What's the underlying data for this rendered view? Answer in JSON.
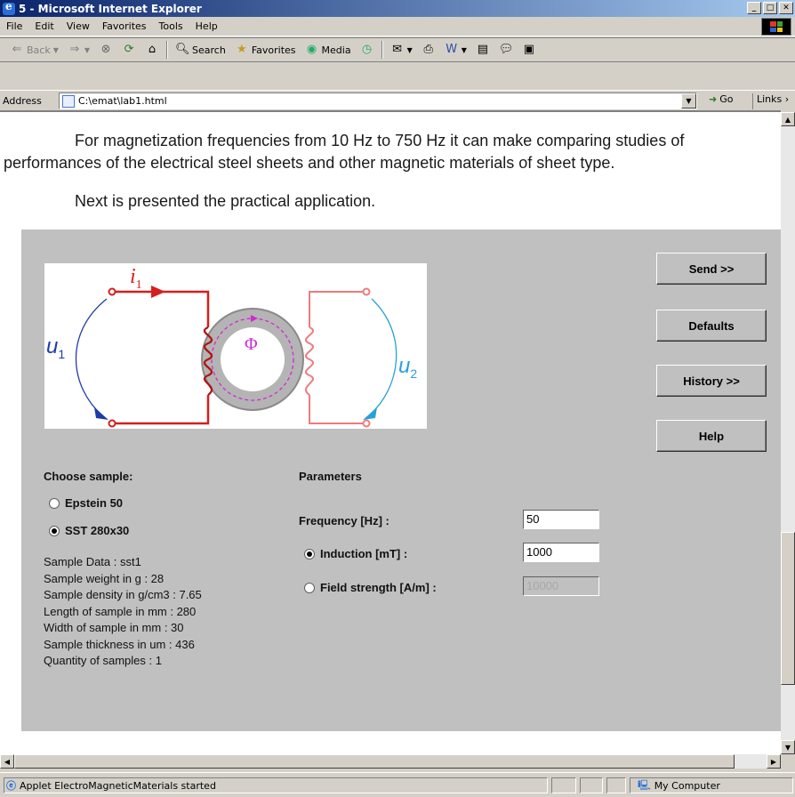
{
  "window": {
    "title": "5 - Microsoft Internet Explorer"
  },
  "menu": [
    "File",
    "Edit",
    "View",
    "Favorites",
    "Tools",
    "Help"
  ],
  "toolbar": {
    "back": "Back",
    "search": "Search",
    "favorites": "Favorites",
    "media": "Media"
  },
  "address": {
    "label": "Address",
    "url": "C:\\emat\\lab1.html",
    "go": "Go",
    "links": "Links"
  },
  "content": {
    "para1_line1": "For magnetization frequencies from 10 Hz to 750 Hz it can make comparing studies of",
    "para1_line2": "performances of the electrical steel sheets and other magnetic materials of sheet type.",
    "para2": "Next is presented the practical application."
  },
  "diagram": {
    "i_label": "i",
    "i_sub": "1",
    "u1_label": "u",
    "u1_sub": "1",
    "u2_label": "u",
    "u2_sub": "2",
    "flux": "Φ"
  },
  "buttons": {
    "send": "Send >>",
    "defaults": "Defaults",
    "history": "History >>",
    "help": "Help"
  },
  "sample": {
    "heading": "Choose sample:",
    "options": [
      {
        "label": "Epstein 50",
        "selected": false
      },
      {
        "label": "SST 280x30",
        "selected": true
      }
    ],
    "data": [
      "Sample Data : sst1",
      "Sample weight in g : 28",
      "Sample density in g/cm3 : 7.65",
      "Length of sample in mm : 280",
      "Width of sample in mm : 30",
      "Sample thickness in um : 436",
      "Quantity of samples : 1"
    ]
  },
  "parameters": {
    "heading": "Parameters",
    "frequency_label": "Frequency [Hz] :",
    "frequency_value": "50",
    "induction_label": "Induction [mT] :",
    "induction_value": "1000",
    "induction_selected": true,
    "field_label": "Field strength [A/m] :",
    "field_value": "10000",
    "field_selected": false
  },
  "status": {
    "text": "Applet ElectroMagneticMaterials started",
    "zone": "My Computer"
  }
}
